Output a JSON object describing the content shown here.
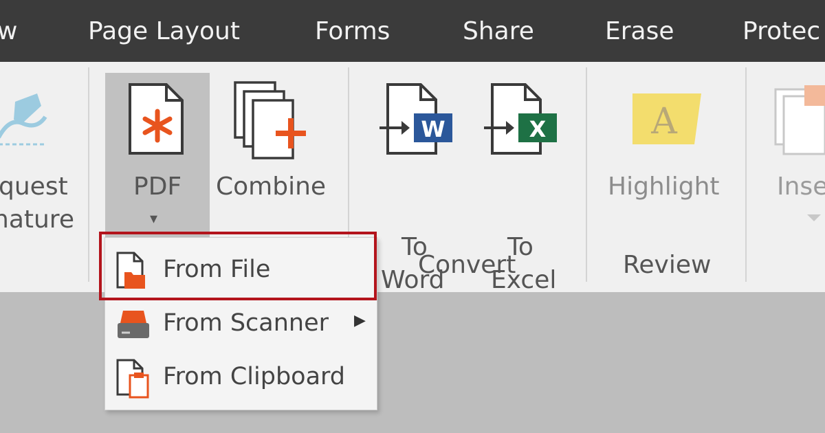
{
  "menubar": {
    "tabs": [
      {
        "label": "w"
      },
      {
        "label": "Page Layout"
      },
      {
        "label": "Forms"
      },
      {
        "label": "Share"
      },
      {
        "label": "Erase"
      },
      {
        "label": "Protec"
      }
    ]
  },
  "ribbon": {
    "request_signature": {
      "line1": "quest",
      "line2": "nature"
    },
    "pdf": {
      "label": "PDF",
      "dropdown_arrow": "▾"
    },
    "combine": {
      "label": "Combine"
    },
    "to_word": {
      "line1": "To",
      "line2": "Word"
    },
    "to_excel": {
      "line1": "To",
      "line2": "Excel"
    },
    "convert_group": {
      "label": "Convert"
    },
    "highlight": {
      "label": "Highlight"
    },
    "review_group": {
      "label": "Review"
    },
    "insert": {
      "label": "Inse"
    }
  },
  "dropdown": {
    "items": [
      {
        "label": "From File",
        "icon": "folder-file-icon"
      },
      {
        "label": "From Scanner",
        "icon": "scanner-icon",
        "submenu_arrow": "▶"
      },
      {
        "label": "From Clipboard",
        "icon": "clipboard-icon"
      }
    ]
  },
  "colors": {
    "menubar": "#3b3b3b",
    "ribbon": "#f0f0f0",
    "accent_orange": "#e8541e",
    "word_blue": "#2b579a",
    "excel_green": "#1e7145",
    "highlight_yellow": "#f3dd6d",
    "highlight_box_red": "#b3141c"
  }
}
